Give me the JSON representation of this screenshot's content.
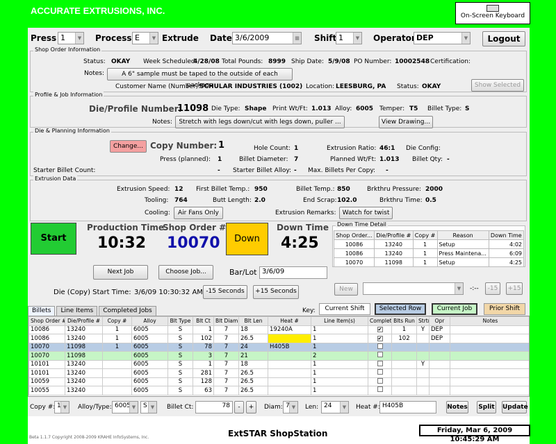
{
  "app": {
    "title": "ACCURATE EXTRUSIONS, INC.",
    "keyboard_label": "On-Screen Keyboard",
    "footer_app": "ExtSTAR ShopStation",
    "copyright": "Beta 1.1.7 Copyright 2008-2009 KRAHE InfoSystems, Inc.",
    "datetime": "Friday, Mar 6, 2009 10:45:29 AM"
  },
  "header": {
    "press_label": "Press",
    "press_value": "1",
    "process_label": "Process",
    "process_value": "E",
    "process_text": "Extrude",
    "date_label": "Date",
    "date_value": "3/6/2009",
    "shift_label": "Shift",
    "shift_value": "1",
    "operator_label": "Operator",
    "operator_value": "DEP",
    "logout_label": "Logout"
  },
  "shop_order": {
    "legend": "Shop Order Information",
    "status_label": "Status:",
    "status_value": "OKAY",
    "week_label": "Week Scheduled:",
    "week_value": "4/28/08",
    "pounds_label": "Total Pounds:",
    "pounds_value": "8999",
    "ship_label": "Ship Date:",
    "ship_value": "5/9/08",
    "po_label": "PO Number:",
    "po_value": "10002548",
    "cert_label": "Certification:",
    "notes_label": "Notes:",
    "notes_value": "A 6\" sample must be taped to the outside of each package",
    "show_selected": "Show Selected",
    "customer_label": "Customer Name (Number):",
    "customer_value": "SCHULAR INDUSTRIES (1002)",
    "location_label": "Location:",
    "location_value": "LEESBURG, PA",
    "status2_label": "Status:",
    "status2_value": "OKAY"
  },
  "profile": {
    "legend": "Profile & Job Information",
    "die_label": "Die/Profile Number:",
    "die_value": "11098",
    "dietype_label": "Die Type:",
    "dietype_value": "Shape",
    "printwt_label": "Print Wt/Ft:",
    "printwt_value": "1.013",
    "alloy_label": "Alloy:",
    "alloy_value": "6005",
    "temper_label": "Temper:",
    "temper_value": "T5",
    "billettype_label": "Billet Type:",
    "billettype_value": "S",
    "notes_label": "Notes:",
    "notes_value": "Stretch with legs down/cut with legs down, puller ...",
    "view_drawing": "View Drawing..."
  },
  "planning": {
    "legend": "Die & Planning Information",
    "change_label": "Change...",
    "copy_label": "Copy Number:",
    "copy_value": "1",
    "hole_label": "Hole Count:",
    "hole_value": "1",
    "ratio_label": "Extrusion Ratio:",
    "ratio_value": "46:1",
    "dieconfig_label": "Die Config:",
    "press_planned_label": "Press (planned):",
    "press_planned_value": "1",
    "billet_dia_label": "Billet Diameter:",
    "billet_dia_value": "7",
    "planned_wt_label": "Planned Wt/Ft:",
    "planned_wt_value": "1.013",
    "billet_qty_label": "Billet Qty:",
    "billet_qty_value": "-",
    "starter_count_label": "Starter Billet Count:",
    "starter_count_value": "-",
    "starter_alloy_label": "Starter Billet Alloy:",
    "starter_alloy_value": "-",
    "max_billets_label": "Max. Billets Per Copy:",
    "max_billets_value": "-"
  },
  "extrusion": {
    "legend": "Extrusion Data",
    "speed_label": "Extrusion Speed:",
    "speed_value": "12",
    "first_temp_label": "First Billet Temp.:",
    "first_temp_value": "950",
    "billet_temp_label": "Billet Temp.:",
    "billet_temp_value": "850",
    "brk_pressure_label": "Brkthru Pressure:",
    "brk_pressure_value": "2000",
    "tooling_label": "Tooling:",
    "tooling_value": "764",
    "butt_label": "Butt Length:",
    "butt_value": "2.0",
    "end_scrap_label": "End Scrap:",
    "end_scrap_value": "102.0",
    "brk_time_label": "Brkthru Time:",
    "brk_time_value": "0.5",
    "cooling_label": "Cooling:",
    "cooling_value": "Air Fans Only",
    "remarks_label": "Extrusion Remarks:",
    "remarks_value": "Watch for twist"
  },
  "status": {
    "start_label": "Start",
    "production_time_label": "Production Time",
    "production_time_value": "10:32",
    "shop_order_label": "Shop Order #",
    "shop_order_value": "10070",
    "down_label": "Down",
    "down_time_label": "Down Time",
    "down_time_value": "4:25",
    "next_job": "Next Job",
    "choose_job": "Choose Job...",
    "barlot_label": "Bar/Lot",
    "barlot_value": "3/6/09",
    "die_start_label": "Die (Copy) Start Time:",
    "die_start_value": "3/6/09 10:30:32 AM",
    "minus15": "-15 Seconds",
    "plus15": "+15 Seconds"
  },
  "downtime": {
    "legend": "Down Time Detail",
    "headers": [
      "Shop Order...",
      "Die/Profile #",
      "Copy #",
      "Reason",
      "Down Time"
    ],
    "rows": [
      [
        "10086",
        "13240",
        "1",
        "Setup",
        "4:02"
      ],
      [
        "10086",
        "13240",
        "1",
        "Press Maintena...",
        "6:09"
      ],
      [
        "10070",
        "11098",
        "1",
        "Setup",
        "4:25"
      ]
    ],
    "new_label": "New",
    "time_value": "-:--",
    "minus15": "-15",
    "plus15": "+15"
  },
  "tabs": [
    "Billets",
    "Line Items",
    "Completed Jobs"
  ],
  "key": {
    "label": "Key:",
    "current_shift": "Current Shift",
    "selected_row": "Selected Row",
    "current_job": "Current Job",
    "prior_shift": "Prior Shift",
    "colors": {
      "selected": "#b8cce4",
      "current_job": "#c6f5c6",
      "prior_shift": "#f2d7a8"
    }
  },
  "grid": {
    "headers": [
      "Shop Order #",
      "Die/Profile #",
      "Copy #",
      "Alloy",
      "Blt Type",
      "Blt Ct",
      "Blt Diam",
      "Blt Len",
      "Heat #",
      "Line Item(s)",
      "Complete",
      "Blts Run",
      "Strtr",
      "Opr",
      "Notes"
    ],
    "rows": [
      {
        "cells": [
          "10086",
          "13240",
          "1",
          "6005",
          "S",
          "1",
          "7",
          "18",
          "19240A",
          "1",
          "✔",
          "1",
          "Y",
          "DEP",
          ""
        ],
        "style": "prior"
      },
      {
        "cells": [
          "10086",
          "13240",
          "1",
          "6005",
          "S",
          "102",
          "7",
          "26.5",
          "",
          "1",
          "✔",
          "102",
          "",
          "DEP",
          ""
        ],
        "style": "prior"
      },
      {
        "cells": [
          "10070",
          "11098",
          "1",
          "6005",
          "S",
          "78",
          "7",
          "24",
          "H405B",
          "1",
          "",
          "",
          "",
          "",
          ""
        ],
        "style": "selected"
      },
      {
        "cells": [
          "10070",
          "11098",
          "",
          "6005",
          "S",
          "3",
          "7",
          "21",
          "",
          "2",
          "",
          "",
          "",
          "",
          ""
        ],
        "style": "job"
      },
      {
        "cells": [
          "10101",
          "13240",
          "",
          "6005",
          "S",
          "1",
          "7",
          "18",
          "",
          "1",
          "",
          "",
          "Y",
          "",
          ""
        ],
        "style": "plain"
      },
      {
        "cells": [
          "10101",
          "13240",
          "",
          "6005",
          "S",
          "281",
          "7",
          "26.5",
          "",
          "1",
          "",
          "",
          "",
          "",
          ""
        ],
        "style": "plain"
      },
      {
        "cells": [
          "10059",
          "13240",
          "",
          "6005",
          "S",
          "128",
          "7",
          "26.5",
          "",
          "1",
          "",
          "",
          "",
          "",
          ""
        ],
        "style": "plain"
      },
      {
        "cells": [
          "10055",
          "13240",
          "",
          "6005",
          "S",
          "63",
          "7",
          "26.5",
          "",
          "1",
          "",
          "",
          "",
          "",
          ""
        ],
        "style": "plain"
      }
    ]
  },
  "bottom": {
    "copy_label": "Copy #:",
    "copy_value": "1",
    "alloy_label": "Alloy/Type:",
    "alloy_value": "6005",
    "type_value": "S",
    "billet_ct_label": "Billet Ct:",
    "billet_ct_value": "78",
    "minus": "-",
    "plus": "+",
    "diam_label": "Diam:",
    "diam_value": "7",
    "len_label": "Len:",
    "len_value": "24",
    "heat_label": "Heat #:",
    "heat_value": "H405B",
    "notes": "Notes",
    "split": "Split",
    "update": "Update"
  }
}
